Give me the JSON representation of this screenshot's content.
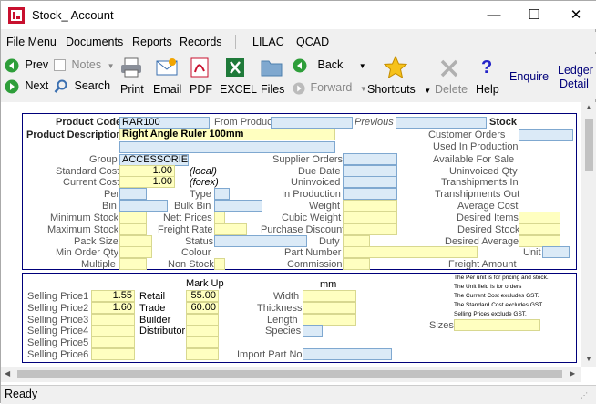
{
  "window": {
    "title": "Stock_ Account",
    "minimize": "—",
    "maximize": "☐",
    "close": "✕"
  },
  "menu": [
    "File Menu",
    "Documents",
    "Reports",
    "Records",
    "LILAC",
    "QCAD"
  ],
  "toolbar": {
    "prev": "Prev",
    "next": "Next",
    "notes": "Notes",
    "search": "Search",
    "print": "Print",
    "email": "Email",
    "pdf": "PDF",
    "excel": "EXCEL",
    "files": "Files",
    "back": "Back",
    "forward": "Forward",
    "shortcuts": "Shortcuts",
    "delete": "Delete",
    "help": "Help",
    "enquire": "Enquire",
    "ledger": "Ledger",
    "detail": "Detail"
  },
  "form": {
    "product_code_label": "Product Code",
    "product_code": "RAR100",
    "from_product_label": "From Product",
    "previous_label": "Previous",
    "stock_label": "Stock",
    "product_description_label": "Product Description",
    "product_description": "Right Angle Ruler 100mm",
    "group_label": "Group",
    "group": "ACCESSORIES",
    "standard_cost_label": "Standard Cost",
    "standard_cost": "1.00",
    "local": "(local)",
    "current_cost_label": "Current Cost",
    "current_cost": "1.00",
    "forex": "(forex)",
    "per_label": "Per",
    "bin_label": "Bin",
    "minimum_stock_label": "Minimum Stock",
    "maximum_stock_label": "Maximum Stock",
    "pack_size_label": "Pack Size",
    "min_order_qty_label": "Min Order Qty",
    "multiple_label": "Multiple",
    "type_label": "Type",
    "bulk_bin_label": "Bulk Bin",
    "nett_prices_label": "Nett Prices",
    "freight_rate_label": "Freight Rate",
    "status_label": "Status",
    "colour_label": "Colour",
    "non_stock_label": "Non Stock",
    "supplier_orders_label": "Supplier Orders",
    "due_date_label": "Due Date",
    "uninvoiced_label": "Uninvoiced",
    "in_production_label": "In Production",
    "weight_label": "Weight",
    "cubic_weight_label": "Cubic Weight",
    "purchase_discount_label": "Purchase Discount",
    "duty_label": "Duty",
    "part_number_label": "Part Number",
    "commission_label": "Commission",
    "customer_orders_label": "Customer Orders",
    "used_in_production_label": "Used In Production",
    "available_for_sale_label": "Available For Sale",
    "uninvoiced_qty_label": "Uninvoiced Qty",
    "transhipments_in_label": "Transhipments In",
    "transhipments_out_label": "Transhipments Out",
    "average_cost_label": "Average Cost",
    "desired_items_label": "Desired Items",
    "desired_stock_label": "Desired Stock",
    "desired_average_label": "Desired Average",
    "unit_label": "Unit",
    "freight_amount_label": "Freight Amount"
  },
  "pricing": {
    "mark_up_label": "Mark Up",
    "mm_label": "mm",
    "selling_price1_label": "Selling Price1",
    "selling_price1": "1.55",
    "selling_price2_label": "Selling Price2",
    "selling_price2": "1.60",
    "selling_price3_label": "Selling Price3",
    "selling_price4_label": "Selling Price4",
    "selling_price5_label": "Selling Price5",
    "selling_price6_label": "Selling Price6",
    "retail_label": "Retail",
    "retail_markup": "55.00",
    "trade_label": "Trade",
    "trade_markup": "60.00",
    "builder_label": "Builder",
    "distributor_label": "Distributor",
    "width_label": "Width",
    "thickness_label": "Thickness",
    "length_label": "Length",
    "species_label": "Species",
    "import_part_no_label": "Import Part No",
    "sizes_label": "Sizes",
    "notes": [
      "The Per unit is for pricing and stock.",
      "The Unit field is for orders",
      "The Current Cost excludes GST.",
      "The Standard Cost excludes GST.",
      "Selling Prices exclude GST."
    ]
  },
  "status": {
    "text": "Ready"
  },
  "colors": {
    "accent": "#00007a",
    "field_blue": "#dbeaf7",
    "field_yellow": "#ffffc0"
  }
}
